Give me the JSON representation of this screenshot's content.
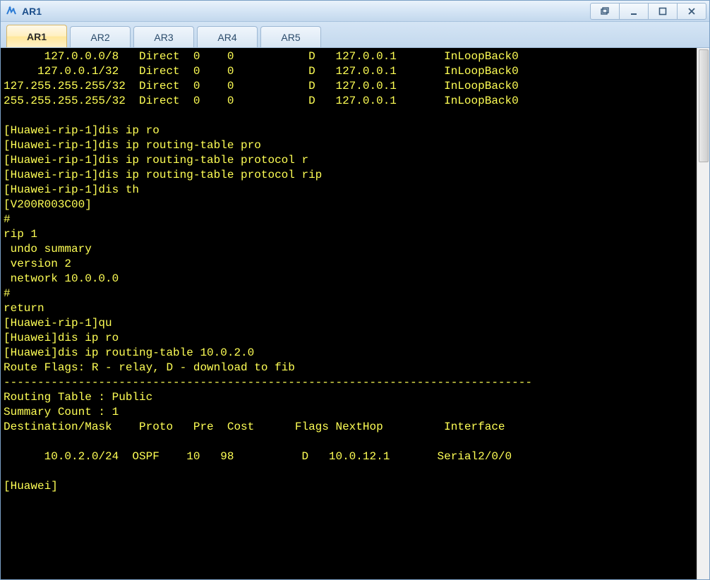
{
  "window": {
    "title": "AR1"
  },
  "tabs": [
    {
      "label": "AR1",
      "active": true
    },
    {
      "label": "AR2",
      "active": false
    },
    {
      "label": "AR3",
      "active": false
    },
    {
      "label": "AR4",
      "active": false
    },
    {
      "label": "AR5",
      "active": false
    }
  ],
  "terminal": {
    "lines": [
      "      127.0.0.0/8   Direct  0    0           D   127.0.0.1       InLoopBack0",
      "     127.0.0.1/32   Direct  0    0           D   127.0.0.1       InLoopBack0",
      "127.255.255.255/32  Direct  0    0           D   127.0.0.1       InLoopBack0",
      "255.255.255.255/32  Direct  0    0           D   127.0.0.1       InLoopBack0",
      "",
      "[Huawei-rip-1]dis ip ro",
      "[Huawei-rip-1]dis ip routing-table pro",
      "[Huawei-rip-1]dis ip routing-table protocol r",
      "[Huawei-rip-1]dis ip routing-table protocol rip",
      "[Huawei-rip-1]dis th",
      "[V200R003C00]",
      "#",
      "rip 1",
      " undo summary",
      " version 2",
      " network 10.0.0.0",
      "#",
      "return",
      "[Huawei-rip-1]qu",
      "[Huawei]dis ip ro",
      "[Huawei]dis ip routing-table 10.0.2.0",
      "Route Flags: R - relay, D - download to fib",
      "------------------------------------------------------------------------------",
      "Routing Table : Public",
      "Summary Count : 1",
      "Destination/Mask    Proto   Pre  Cost      Flags NextHop         Interface",
      "",
      "      10.0.2.0/24  OSPF    10   98          D   10.0.12.1       Serial2/0/0",
      "",
      "[Huawei]"
    ]
  }
}
